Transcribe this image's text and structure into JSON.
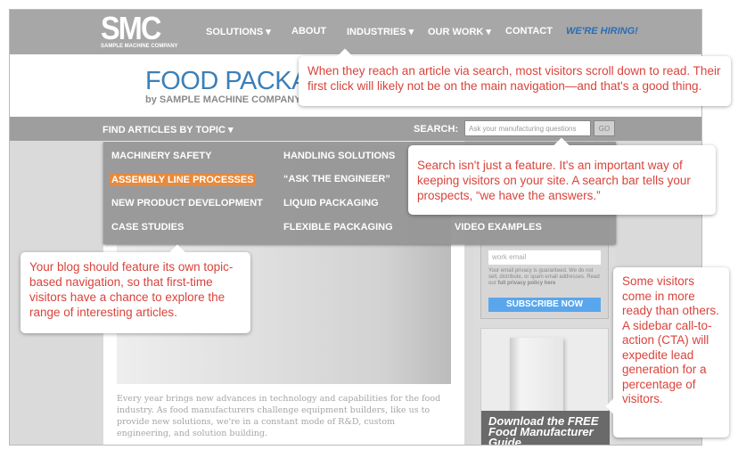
{
  "nav": {
    "logo": "SMC",
    "logo_sub": "SAMPLE MACHINE COMPANY",
    "items": [
      "SOLUTIONS ▾",
      "ABOUT",
      "INDUSTRIES ▾",
      "OUR WORK ▾",
      "CONTACT"
    ],
    "hiring": "WE'RE HIRING!"
  },
  "header": {
    "title": "FOOD PACKAGING",
    "subtitle": "by SAMPLE MACHINE COMPANY"
  },
  "topicbar": {
    "topics_label": "FIND ARTICLES BY TOPIC ▾",
    "search_label": "SEARCH:",
    "search_placeholder": "Ask your manufacturing questions",
    "go": "GO"
  },
  "dropdown": {
    "col1": [
      "MACHINERY SAFETY",
      "ASSEMBLY LINE PROCESSES",
      "NEW PRODUCT DEVELOPMENT",
      "CASE STUDIES"
    ],
    "col2": [
      "HANDLING SOLUTIONS",
      "“ASK THE ENGINEER”",
      "LIQUID PACKAGING",
      "FLEXIBLE PACKAGING"
    ],
    "col3": [
      "VIDEO EXAMPLES"
    ]
  },
  "article": {
    "paragraph": "Every year brings new advances in technology and capabilities for the food industry. As food manufacturers challenge equipment builders, like us to provide new solutions, we're in a constant mode of R&D, custom engineering, and solution building."
  },
  "sidebar": {
    "email_placeholder": "work email",
    "privacy": "Your email privacy is guaranteed. We do not sell, distribute, or spam email addresses. Read our",
    "privacy_link": "full privacy policy here",
    "subscribe": "SUBSCRIBE NOW",
    "cta": "Download the FREE Food Manufacturer Guide"
  },
  "callouts": {
    "nav": "When they reach an article via search, most visitors scroll down to read. Their first click will likely not be on the main navigation—and that's a good thing.",
    "search": "Search isn't just a feature. It's an important way of keeping visitors on your site. A search bar tells your prospects, “we have the answers.”",
    "topics": "Your blog should feature its own topic-based navigation, so that first-time visitors have a chance to explore the range of interesting articles.",
    "cta": "Some visitors come in more ready than others. A sidebar call-to-action (CTA) will expedite lead generation for a percentage of visitors."
  },
  "colors": {
    "callout_text": "#d9433b",
    "highlight": "#e8893b",
    "hiring": "#2a6db5",
    "subscribe": "#5aa6ec"
  }
}
